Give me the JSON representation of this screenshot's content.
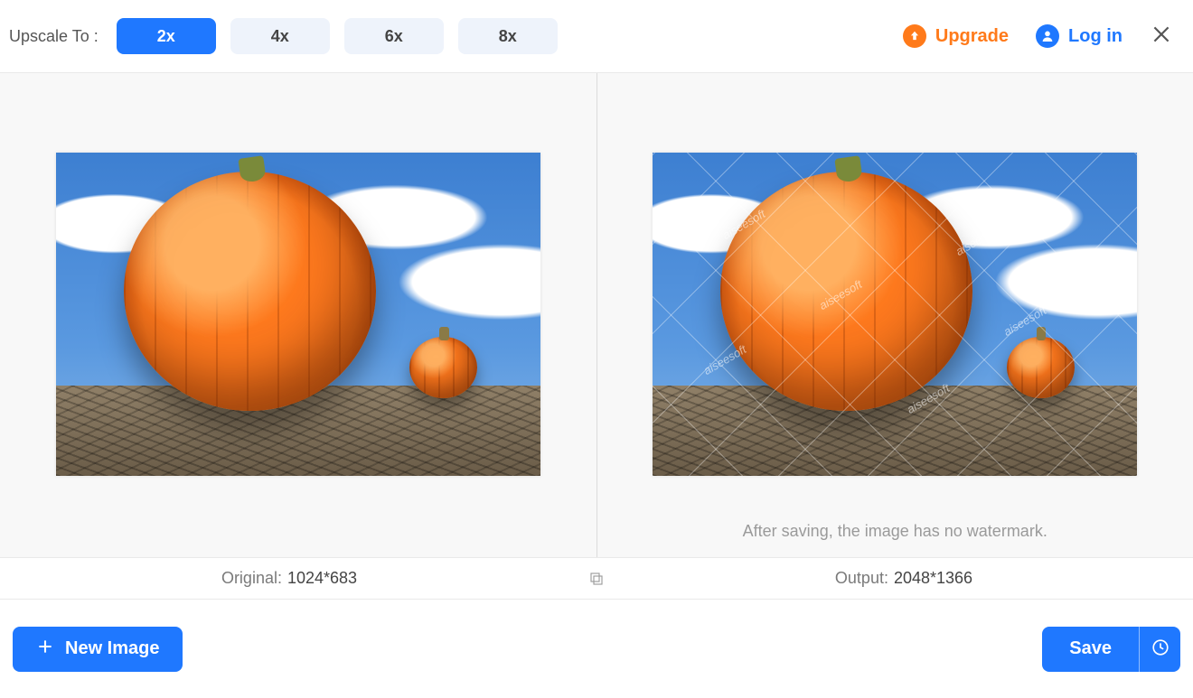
{
  "header": {
    "upscale_label": "Upscale To :",
    "scales": [
      "2x",
      "4x",
      "6x",
      "8x"
    ],
    "selected_scale": "2x",
    "upgrade_label": "Upgrade",
    "login_label": "Log in"
  },
  "comparison": {
    "watermark_text": "aiseesoft",
    "watermark_note": "After saving, the image has no watermark."
  },
  "dimensions": {
    "original_label": "Original:",
    "original_value": "1024*683",
    "output_label": "Output:",
    "output_value": "2048*1366"
  },
  "footer": {
    "new_image_label": "New Image",
    "save_label": "Save"
  }
}
